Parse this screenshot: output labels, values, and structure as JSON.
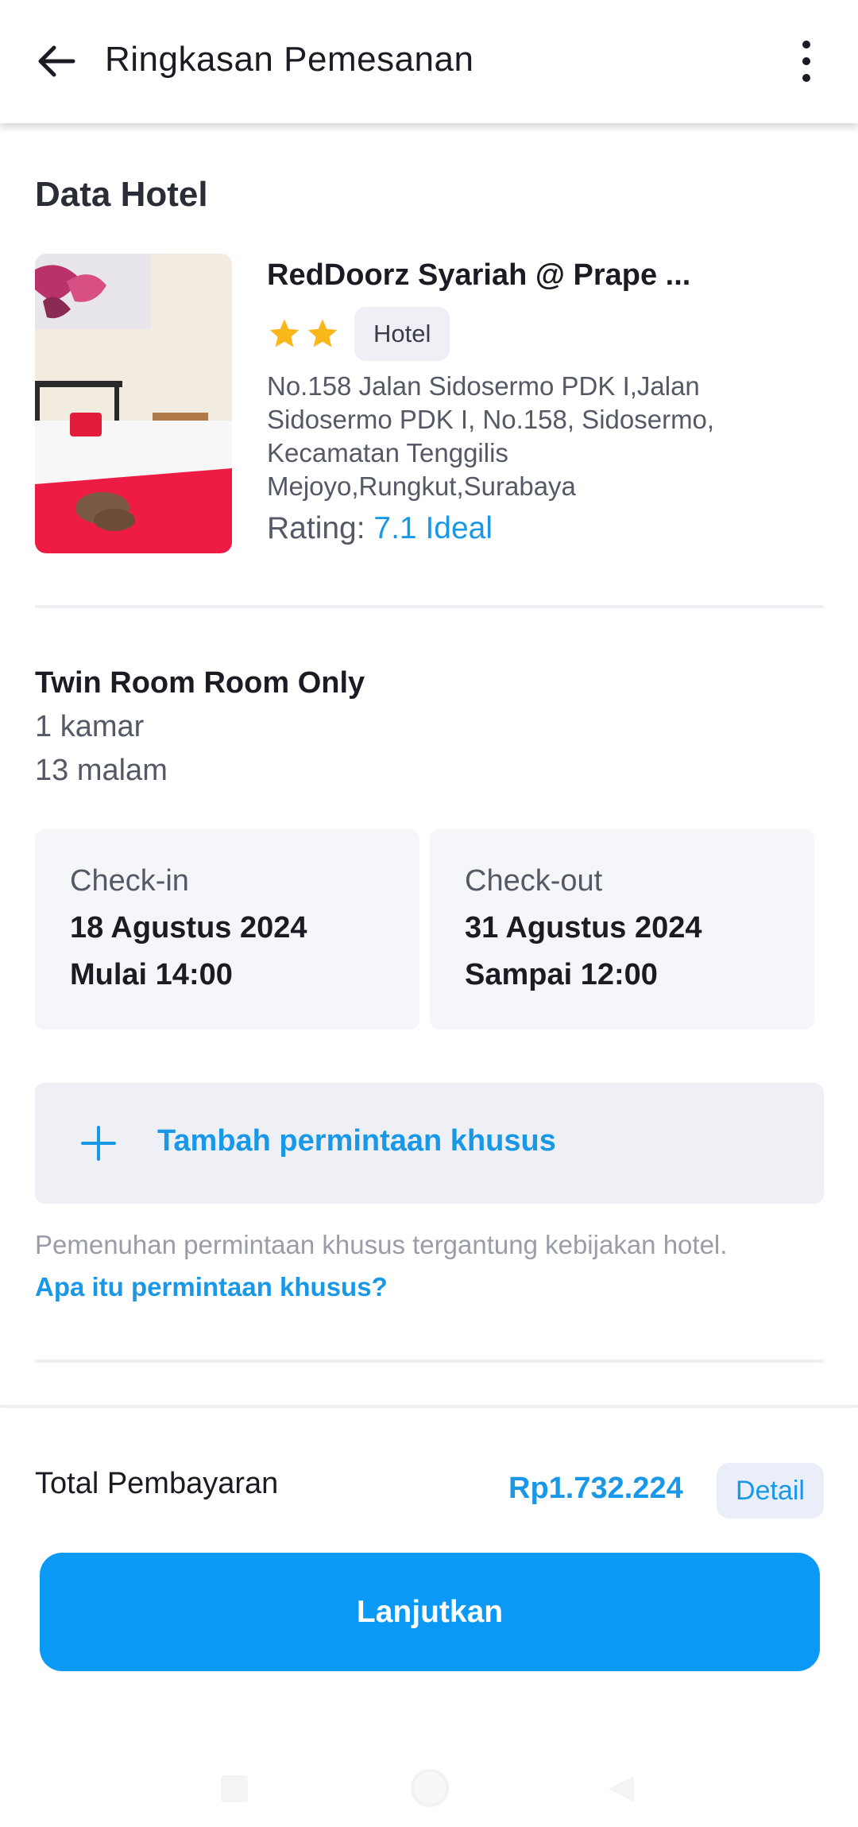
{
  "appbar": {
    "title": "Ringkasan Pemesanan",
    "back_icon": "arrow-left-icon",
    "menu_icon": "more-vertical-icon"
  },
  "hotel": {
    "section_title": "Data Hotel",
    "name": "RedDoorz Syariah @ Prape ...",
    "stars": 2,
    "type": "Hotel",
    "address": "No.158 Jalan Sidosermo PDK I,Jalan Sidosermo PDK I, No.158, Sidosermo, Kecamatan Tenggilis Mejoyo,Rungkut,Surabaya",
    "rating_label": "Rating: ",
    "rating_value": "7.1 Ideal",
    "colors": {
      "accent": "#1a98e8",
      "star": "#f8b81b"
    }
  },
  "room": {
    "name": "Twin Room Room Only",
    "quantity": "1 kamar",
    "nights": "13 malam"
  },
  "checkin": {
    "label": "Check-in",
    "date": "18 Agustus 2024",
    "time": "Mulai 14:00"
  },
  "checkout": {
    "label": "Check-out",
    "date": "31 Agustus 2024",
    "time": "Sampai 12:00"
  },
  "special_request": {
    "button_label": "Tambah permintaan khusus",
    "note": "Pemenuhan permintaan khusus tergantung kebijakan hotel.",
    "link": "Apa itu permintaan khusus?"
  },
  "payment": {
    "total_label": "Total Pembayaran",
    "total_value": "Rp1.732.224",
    "detail_label": "Detail"
  },
  "cta": {
    "label": "Lanjutkan",
    "color": "#0a99f5"
  }
}
